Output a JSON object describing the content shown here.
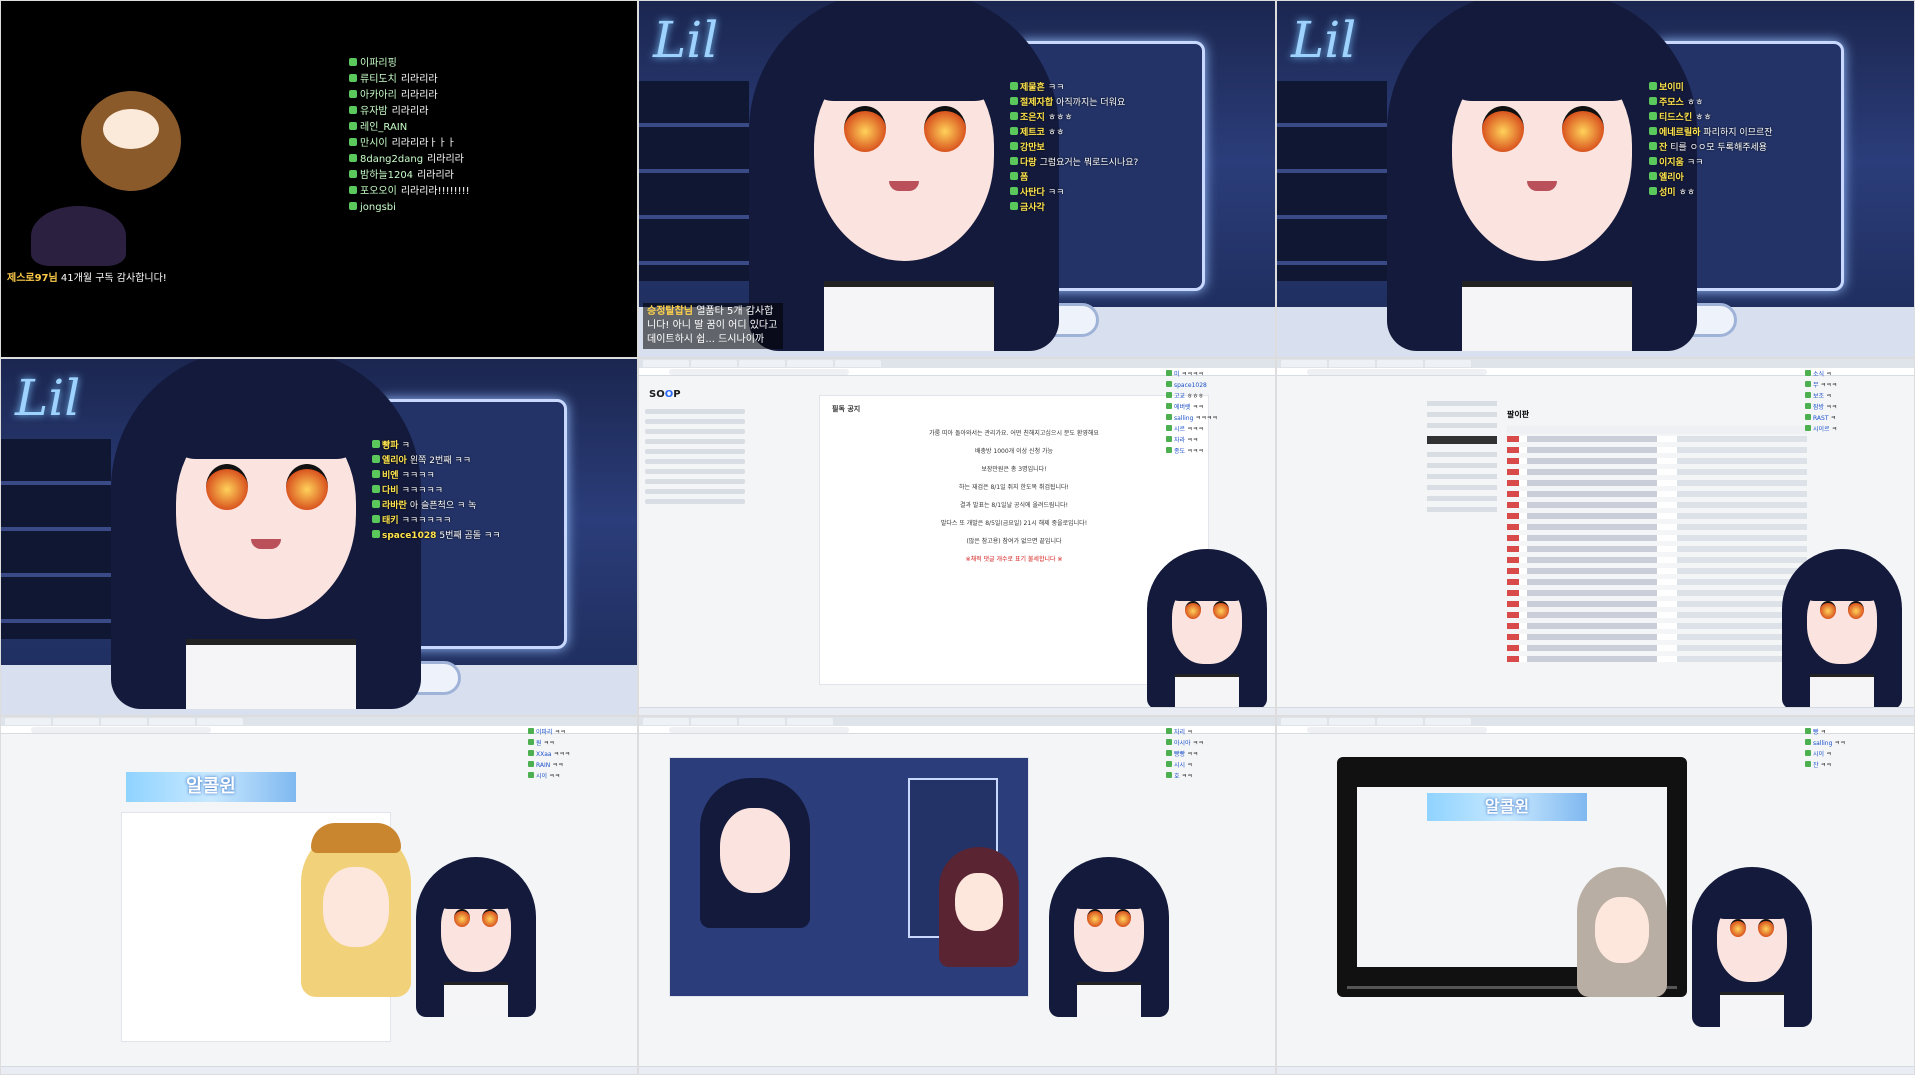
{
  "tile1": {
    "chat": [
      {
        "user": "이파리핑",
        "msg": ""
      },
      {
        "user": "류티도치",
        "msg": "리라리라"
      },
      {
        "user": "아카아리",
        "msg": "리라리라"
      },
      {
        "user": "유자밤",
        "msg": "리라리라"
      },
      {
        "user": "레인_RAIN",
        "msg": ""
      },
      {
        "user": "만시이",
        "msg": "리라리라ㅏㅏㅏ"
      },
      {
        "user": "8dang2dang",
        "msg": "리라리라"
      },
      {
        "user": "밤하늘1204",
        "msg": "리라리라"
      },
      {
        "user": "포오오이",
        "msg": "리라리라!!!!!!!!"
      },
      {
        "user": "jongsbi",
        "msg": ""
      }
    ],
    "thanks_user": "제스로97님",
    "thanks_text": "41개월 구독 감사합니다!"
  },
  "tile2": {
    "chat": [
      {
        "user": "제물흔",
        "msg": "ㅋㅋ"
      },
      {
        "user": "절제자합",
        "msg": "아직까지는 더워요"
      },
      {
        "user": "조은지",
        "msg": "ㅎㅎㅎ"
      },
      {
        "user": "제트코",
        "msg": "ㅎㅎ"
      },
      {
        "user": "강만보",
        "msg": ""
      },
      {
        "user": "다랑",
        "msg": "그럼요거는 뭐로드시나요?"
      },
      {
        "user": "폼",
        "msg": ""
      },
      {
        "user": "사탄다",
        "msg": "ㅋㅋ"
      },
      {
        "user": "금사각",
        "msg": ""
      }
    ],
    "sub_user": "승정탈찹님",
    "sub_text": "열품타 5개 감사합니다! 아니 딸 꿈이 어디 있다고 데이트하시 쉽... 드시나이까"
  },
  "tile3": {
    "chat": [
      {
        "user": "보이미",
        "msg": ""
      },
      {
        "user": "주모스",
        "msg": "ㅎㅎ"
      },
      {
        "user": "티드스킨",
        "msg": "ㅎㅎ"
      },
      {
        "user": "에네르릴하",
        "msg": "파리하지 이므르잔"
      },
      {
        "user": "잔",
        "msg": "티를 ㅇㅇ모 두록해주세용"
      },
      {
        "user": "이지움",
        "msg": "ㅋㅋ"
      },
      {
        "user": "엘리아",
        "msg": ""
      },
      {
        "user": "성미",
        "msg": "ㅎㅎ"
      }
    ]
  },
  "tile4": {
    "chat": [
      {
        "user": "빵파",
        "msg": "ㅋ"
      },
      {
        "user": "엘리아",
        "msg": "왼쪽 2번째 ㅋㅋ"
      },
      {
        "user": "비엔",
        "msg": "ㅋㅋㅋㅋ"
      },
      {
        "user": "다비",
        "msg": "ㅋㅋㅋㅋㅋ"
      },
      {
        "user": "라바란",
        "msg": "아 슬픈척으 ㅋ 녹"
      },
      {
        "user": "태키",
        "msg": "ㅋㅋㅋㅋㅋㅋ"
      },
      {
        "user": "space1028",
        "msg": "5번째 곰돌 ㅋㅋ"
      }
    ]
  },
  "tile5": {
    "logo_a": "SO",
    "logo_b": "O",
    "logo_c": "P",
    "doc_title": "필독 공지",
    "lines": [
      "가룸 띠아 돌아와서는 관리가요. 어떤 친해지고십으시 분도 환영해요",
      "배충방 1000개 이상 신청 가능",
      "보장만원은 총 3명입니다!",
      "하는 재검은 8/1일 쥐지 한도복 취검됩니다!",
      "결과 발표는 8/1일날 공식에 올려드림니다!",
      "발다스 또 개발은 8/5일(금요일) 21시 해제 중을로입니다!",
      "(많은 참고용) 참여가 없으면 끝입니다",
      "※채적 댓글 개수로 표기 불세합니다 ※"
    ],
    "chat": [
      {
        "user": "미",
        "msg": "ㅋㅋㅋㅋ"
      },
      {
        "user": "space1028",
        "msg": ""
      },
      {
        "user": "고교",
        "msg": "ㅎㅎㅎ"
      },
      {
        "user": "에버렛",
        "msg": "ㅋㅋ"
      },
      {
        "user": "salling",
        "msg": "ㅋㅋㅋㅋ"
      },
      {
        "user": "시르",
        "msg": "ㅋㅋㅋ"
      },
      {
        "user": "자라",
        "msg": "ㅋㅋ"
      },
      {
        "user": "종도",
        "msg": "ㅋㅋㅋ"
      }
    ]
  },
  "tile6": {
    "board_title": "팔이판",
    "chat": [
      {
        "user": "소식",
        "msg": "ㅋ"
      },
      {
        "user": "무",
        "msg": "ㅋㅋㅋ"
      },
      {
        "user": "보조",
        "msg": "ㅋ"
      },
      {
        "user": "잠방",
        "msg": "ㅋㅋ"
      },
      {
        "user": "RAST",
        "msg": "ㅋ"
      },
      {
        "user": "시이르",
        "msg": "ㅋ"
      }
    ]
  },
  "tile7": {
    "banner": "알콜윈",
    "chat": [
      {
        "user": "이파리",
        "msg": "ㅋㅋ"
      },
      {
        "user": "원",
        "msg": "ㅋㅋ"
      },
      {
        "user": "XXaa",
        "msg": "ㅋㅋㅋ"
      },
      {
        "user": "RAIN",
        "msg": "ㅋㅋ"
      },
      {
        "user": "시이",
        "msg": "ㅋㅋ"
      }
    ]
  },
  "tile8": {
    "chat": [
      {
        "user": "자리",
        "msg": "ㅋ"
      },
      {
        "user": "아시아",
        "msg": "ㅋㅋ"
      },
      {
        "user": "빵빵",
        "msg": "ㅋㅋ"
      },
      {
        "user": "시시",
        "msg": "ㅋ"
      },
      {
        "user": "호",
        "msg": "ㅋㅋ"
      }
    ]
  },
  "tile9": {
    "banner": "알콜윈",
    "chat": [
      {
        "user": "빵",
        "msg": "ㅋ"
      },
      {
        "user": "salling",
        "msg": "ㅋㅋ"
      },
      {
        "user": "시이",
        "msg": "ㅋ"
      },
      {
        "user": "잔",
        "msg": "ㅋㅋ"
      }
    ]
  },
  "neon_text": "Lil",
  "colors": {
    "scene_bg": "#1b2650",
    "chat_user": "#ffe44d",
    "badge": "#5ac85a",
    "accent": "#2b6cff",
    "notice_red": "#d31b1b"
  }
}
